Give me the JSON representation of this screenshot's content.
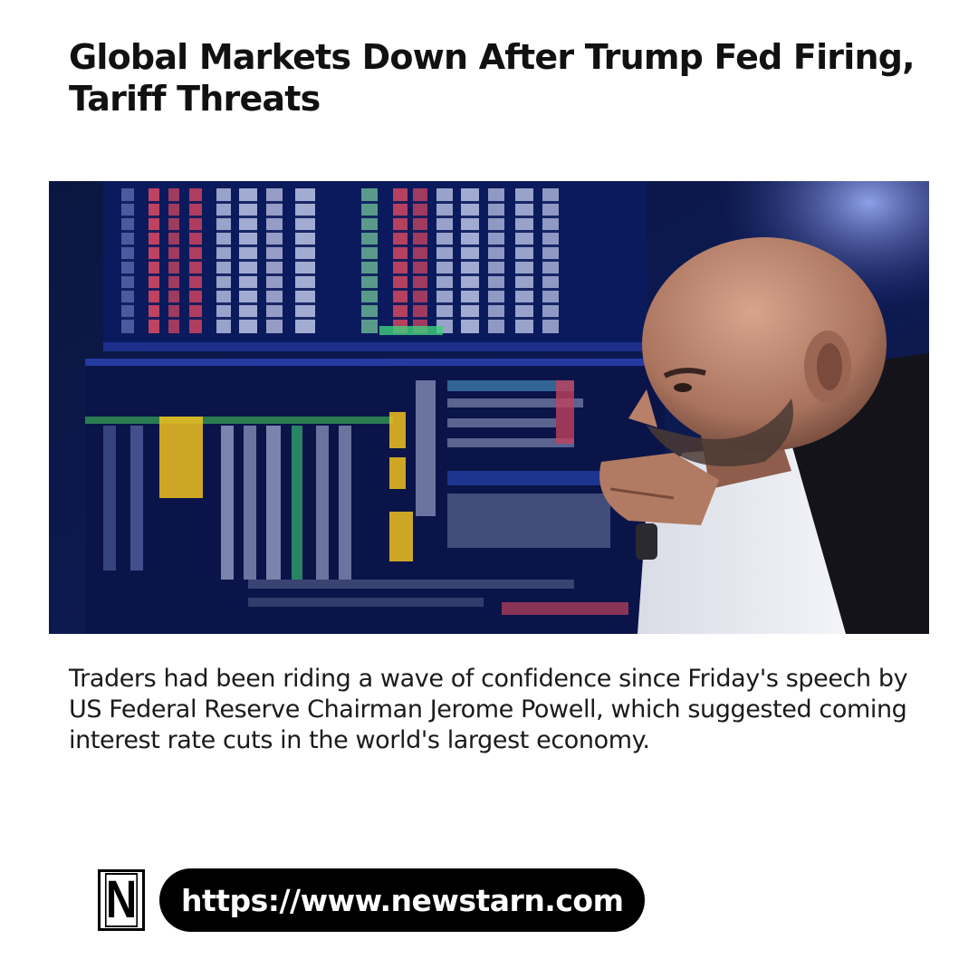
{
  "article": {
    "headline": "Global Markets Down After Trump Fed Firing, Tariff Threats",
    "image": {
      "description_icon": "photo-trader-screens"
    },
    "body": "Traders had been riding a wave of confidence since Friday's speech by US Federal Reserve Chairman Jerome Powell, which suggested coming interest rate cuts in the world's largest economy."
  },
  "footer": {
    "logo_letter": "N",
    "url": "https://www.newstarn.com"
  },
  "colors": {
    "text": "#111111",
    "background": "#ffffff",
    "pill": "#000000",
    "pill_text": "#ffffff"
  }
}
